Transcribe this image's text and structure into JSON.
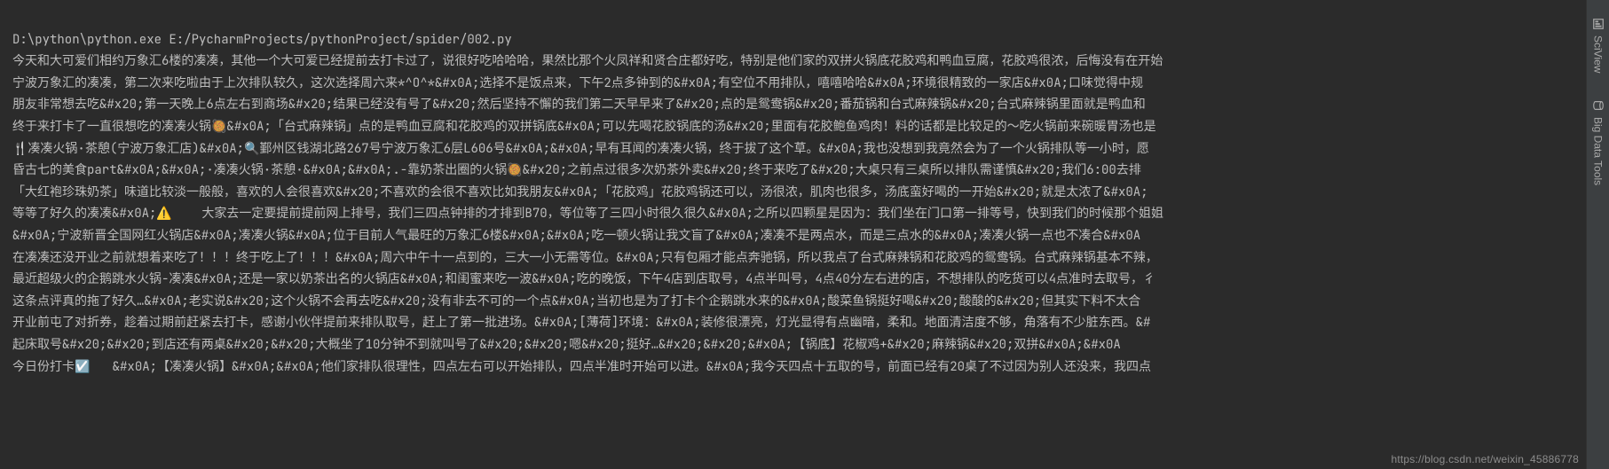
{
  "command_line": "D:\\python\\python.exe E:/PycharmProjects/pythonProject/spider/002.py",
  "output_lines": [
    "今天和大可爱们相约万象汇6楼的凑凑，其他一个大可爱已经提前去打卡过了，说很好吃哈哈哈，果然比那个火凤祥和贤合庄都好吃，特别是他们家的双拼火锅底花胶鸡和鸭血豆腐，花胶鸡很浓，后悔没有在开始",
    "宁波万象汇的凑凑，第二次来吃啦由于上次排队较久，这次选择周六来*^O^*&#x0A;选择不是饭点来，下午2点多钟到的&#x0A;有空位不用排队，嘻嘻哈哈&#x0A;环境很精致的一家店&#x0A;口味觉得中规",
    "朋友非常想去吃&#x20;第一天晚上6点左右到商场&#x20;结果已经没有号了&#x20;然后坚持不懈的我们第二天早早来了&#x20;点的是鸳鸯锅&#x20;番茄锅和台式麻辣锅&#x20;台式麻辣锅里面就是鸭血和",
    "终于来打卡了一直很想吃的凑凑火锅🥘&#x0A;「台式麻辣锅」点的是鸭血豆腐和花胶鸡的双拼锅底&#x0A;可以先喝花胶锅底的汤&#x20;里面有花胶鲍鱼鸡肉！料的话都是比较足的～吃火锅前来碗暖胃汤也是",
    "🍴凑凑火锅·茶憩(宁波万象汇店)&#x0A;🔍鄞州区钱湖北路267号宁波万象汇6层L606号&#x0A;&#x0A;早有耳闻的凑凑火锅，终于拔了这个草。&#x0A;我也没想到我竟然会为了一个火锅排队等一小时，愿",
    "昏古七的美食part&#x0A;&#x0A;·凑凑火锅·茶憩·&#x0A;&#x0A;.-靠奶茶出圈的火锅🥘&#x20;之前点过很多次奶茶外卖&#x20;终于来吃了&#x20;大桌只有三桌所以排队需谨慎&#x20;我们6:00去排",
    "「大红袍珍珠奶茶」味道比较淡一般般，喜欢的人会很喜欢&#x20;不喜欢的会很不喜欢比如我朋友&#x0A;「花胶鸡」花胶鸡锅还可以，汤很浓，肌肉也很多，汤底蛮好喝的一开始&#x20;就是太浓了&#x0A;",
    "等等了好久的凑凑&#x0A;⚠️    大家去一定要提前提前网上排号，我们三四点钟排的才排到B70，等位等了三四小时很久很久&#x0A;之所以四颗星是因为：我们坐在门口第一排等号，快到我们的时候那个姐姐",
    "&#x0A;宁波新晋全国网红火锅店&#x0A;凑凑火锅&#x0A;位于目前人气最旺的万象汇6楼&#x0A;&#x0A;吃一顿火锅让我文盲了&#x0A;凑凑不是两点水，而是三点水的&#x0A;凑凑火锅一点也不凑合&#x0A",
    "在凑凑还没开业之前就想着来吃了！！！终于吃上了！！！&#x0A;周六中午十一点到的，三大一小无需等位。&#x0A;只有包厢才能点奔驰锅，所以我点了台式麻辣锅和花胶鸡的鸳鸯锅。台式麻辣锅基本不辣，",
    "最近超级火的企鹅跳水火锅-凑凑&#x0A;还是一家以奶茶出名的火锅店&#x0A;和闺蜜来吃一波&#x0A;吃的晚饭，下午4店到店取号，4点半叫号，4点40分左右进的店，不想排队的吃货可以4点准时去取号，彳",
    "这条点评真的拖了好久…&#x0A;老实说&#x20;这个火锅不会再去吃&#x20;没有非去不可的一个点&#x0A;当初也是为了打卡个企鹅跳水来的&#x0A;酸菜鱼锅挺好喝&#x20;酸酸的&#x20;但其实下料不太合",
    "开业前屯了对折券，趁着过期前赶紧去打卡，感谢小伙伴提前来排队取号，赶上了第一批进场。&#x0A;[薄荷]环境：&#x0A;装修很漂亮，灯光显得有点幽暗，柔和。地面清洁度不够，角落有不少脏东西。&#",
    "起床取号&#x20;&#x20;到店还有两桌&#x20;&#x20;大概坐了10分钟不到就叫号了&#x20;&#x20;嗯&#x20;挺好…&#x20;&#x20;&#x0A;【锅底】花椒鸡+&#x20;麻辣锅&#x20;双拼&#x0A;&#x0A",
    "今日份打卡☑️   &#x0A;【凑凑火锅】&#x0A;&#x0A;他们家排队很理性，四点左右可以开始排队，四点半准时开始可以进。&#x0A;我今天四点十五取的号，前面已经有20桌了不过因为别人还没来，我四点"
  ],
  "sidetabs": {
    "sciview": "SciView",
    "bigdata": "Big Data Tools"
  },
  "watermark": "https://blog.csdn.net/weixin_45886778"
}
